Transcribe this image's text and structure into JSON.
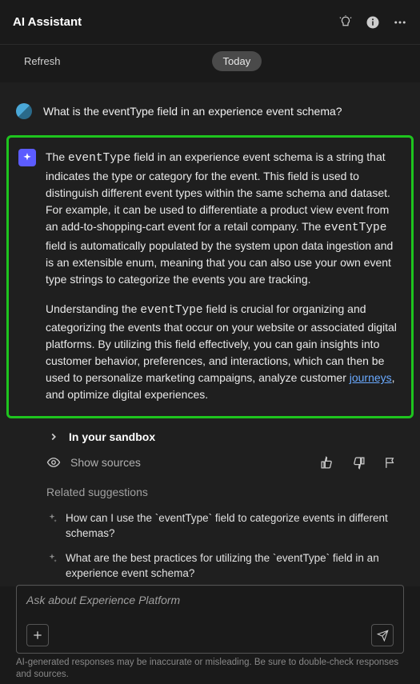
{
  "header": {
    "title": "AI Assistant"
  },
  "chips": {
    "refresh": "Refresh",
    "today": "Today"
  },
  "user_message": "What is the eventType field in an experience event schema?",
  "ai": {
    "p1_a": "The ",
    "p1_code1": "eventType",
    "p1_b": " field in an experience event schema is a string that indicates the type or category for the event. This field is used to distinguish different event types within the same schema and dataset. For example, it can be used to differentiate a product view event from an add-to-shopping-cart event for a retail company. The ",
    "p1_code2": "eventType",
    "p1_c": " field is automatically populated by the system upon data ingestion and is an extensible enum, meaning that you can also use your own event type strings to categorize the events you are tracking.",
    "p2_a": "Understanding the ",
    "p2_code1": "eventType",
    "p2_b": " field is crucial for organizing and categorizing the events that occur on your website or associated digital platforms. By utilizing this field effectively, you can gain insights into customer behavior, preferences, and interactions, which can then be used to personalize marketing campaigns, analyze customer ",
    "p2_link": "journeys",
    "p2_c": ", and optimize digital experiences."
  },
  "sandbox_label": "In your sandbox",
  "show_sources": "Show sources",
  "related": {
    "title": "Related suggestions",
    "items": [
      "How can I use the `eventType` field to categorize events in different schemas?",
      "What are the best practices for utilizing the `eventType` field in an experience event schema?"
    ]
  },
  "input": {
    "placeholder": "Ask about Experience Platform"
  },
  "disclaimer": "AI-generated responses may be inaccurate or misleading. Be sure to double-check responses and sources."
}
